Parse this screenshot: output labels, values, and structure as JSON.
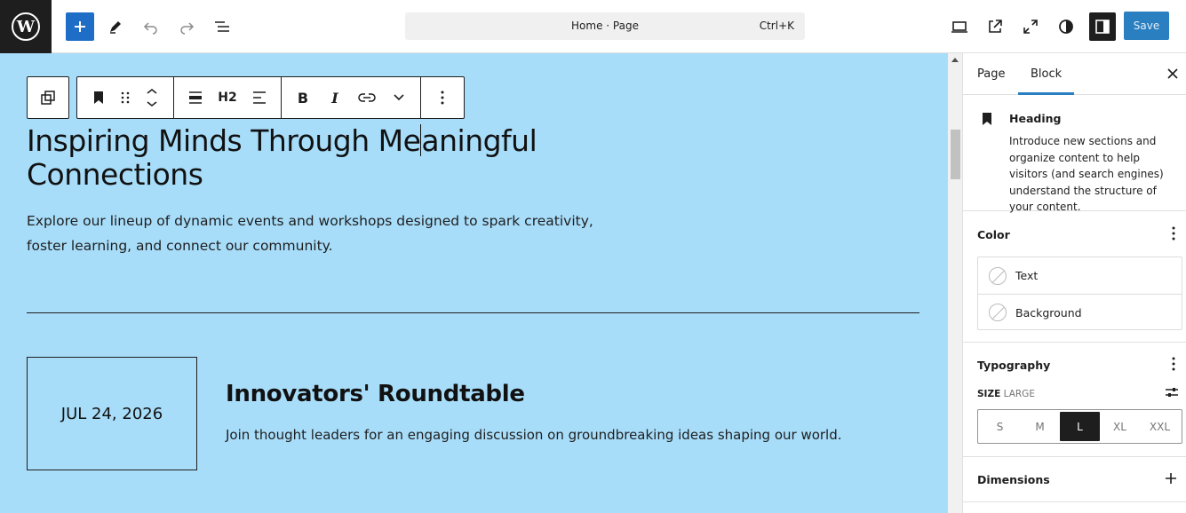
{
  "topbar": {
    "document_title": "Home · Page",
    "shortcut": "Ctrl+K",
    "save_label": "Save"
  },
  "canvas": {
    "heading_before_caret": "Inspiring Minds Through Me",
    "heading_after_caret": "aningful Connections",
    "intro": "Explore our lineup of dynamic events and workshops designed to spark creativity, foster learning, and connect our community.",
    "event": {
      "date": "JUL 24, 2026",
      "title": "Innovators' Roundtable",
      "description": "Join thought leaders for an engaging discussion on groundbreaking ideas shaping our world."
    },
    "block_toolbar": {
      "heading_level": "H2"
    }
  },
  "sidebar": {
    "tabs": [
      "Page",
      "Block"
    ],
    "active_tab": "Block",
    "block": {
      "name": "Heading",
      "description": "Introduce new sections and organize content to help visitors (and search engines) understand the structure of your content."
    },
    "color": {
      "title": "Color",
      "items": [
        "Text",
        "Background"
      ]
    },
    "typography": {
      "title": "Typography",
      "size_key": "SIZE",
      "size_value": "LARGE",
      "sizes": [
        "S",
        "M",
        "L",
        "XL",
        "XXL"
      ],
      "selected_size": "L"
    },
    "dimensions": {
      "title": "Dimensions"
    }
  },
  "colors": {
    "canvas_bg": "#a8ddfa",
    "accent": "#2a7fc0",
    "dark": "#1e1e1e"
  }
}
